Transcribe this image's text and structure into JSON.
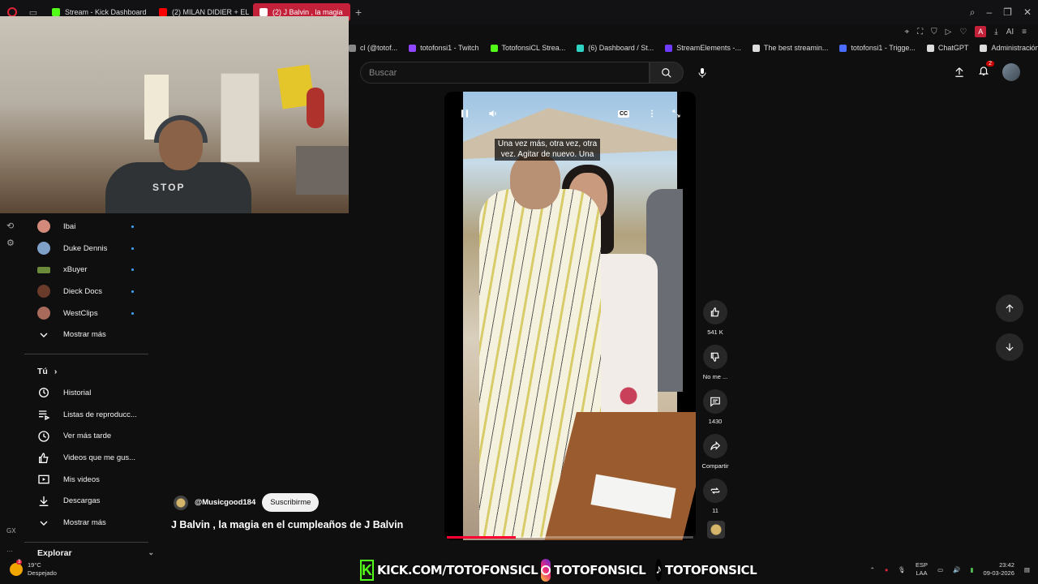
{
  "browser": {
    "tabs": [
      {
        "label": "Stream - Kick Dashboard",
        "color": "#53fc18",
        "active": false
      },
      {
        "label": "(2) MILAN DIDIER + EL BA",
        "color": "#ff0000",
        "active": false
      },
      {
        "label": "(2) J Balvin , la magia",
        "color": "#ff0000",
        "active": true
      }
    ],
    "bookmarks": [
      {
        "label": "cl (@totof...",
        "color": "#888888"
      },
      {
        "label": "totofonsi1 - Twitch",
        "color": "#9146ff"
      },
      {
        "label": "TotofonsiCL Strea...",
        "color": "#53fc18"
      },
      {
        "label": "(6) Dashboard / St...",
        "color": "#2fd3c3"
      },
      {
        "label": "StreamElements -...",
        "color": "#6f3cff"
      },
      {
        "label": "The best streamin...",
        "color": "#dddddd"
      },
      {
        "label": "totofonsi1 - Trigge...",
        "color": "#4a6cff"
      },
      {
        "label": "ChatGPT",
        "color": "#dddddd"
      },
      {
        "label": "Administración - A...",
        "color": "#dddddd"
      }
    ],
    "account_letter": "A",
    "ai_label": "AI"
  },
  "webcam": {
    "shirt_text": "STOP"
  },
  "header": {
    "search_placeholder": "Buscar",
    "notif_count": "2"
  },
  "sidebar": {
    "subscriptions": [
      {
        "label": "Ibai",
        "color": "#d48a7a"
      },
      {
        "label": "Duke Dennis",
        "color": "#7fa1c7"
      },
      {
        "label": "xBuyer",
        "color": "#6b8a3a"
      },
      {
        "label": "Dieck Docs",
        "color": "#6a3a2a"
      },
      {
        "label": "WestClips",
        "color": "#a86a5a"
      }
    ],
    "show_more_1": "Mostrar más",
    "you_section": "Tú",
    "you_items": [
      {
        "label": "Historial",
        "icon": "history-icon"
      },
      {
        "label": "Listas de reproducc...",
        "icon": "playlist-icon"
      },
      {
        "label": "Ver más tarde",
        "icon": "watch-later-icon"
      },
      {
        "label": "Videos que me gus...",
        "icon": "like-icon"
      },
      {
        "label": "Mis videos",
        "icon": "my-videos-icon"
      },
      {
        "label": "Descargas",
        "icon": "download-icon"
      }
    ],
    "show_more_2": "Mostrar más",
    "explore": "Explorar",
    "gx_label": "GX"
  },
  "video": {
    "caption": "Una vez más, otra vez, otra vez.  Agitar de nuevo.  Una",
    "cc_label": "CC",
    "progress": 0.28,
    "channel": "@Musicgood184",
    "subscribe": "Suscribirme",
    "title": "J Balvin , la magia en el cumpleaños de J Balvin"
  },
  "actions": {
    "likes": "541 K",
    "dislike": "No me ...",
    "comments": "1430",
    "share": "Compartir",
    "remix": "11"
  },
  "overlay": {
    "kick": "KICK.COM/TOTOFONSICL",
    "instagram": "TOTOFONSICL",
    "tiktok": "TOTOFONSICL"
  },
  "taskbar": {
    "temp": "19°C",
    "weather": "Despejado",
    "weather_badge": "3",
    "lang_top": "ESP",
    "lang_bottom": "LAA",
    "time": "23:42",
    "date": "09-03-2026"
  }
}
